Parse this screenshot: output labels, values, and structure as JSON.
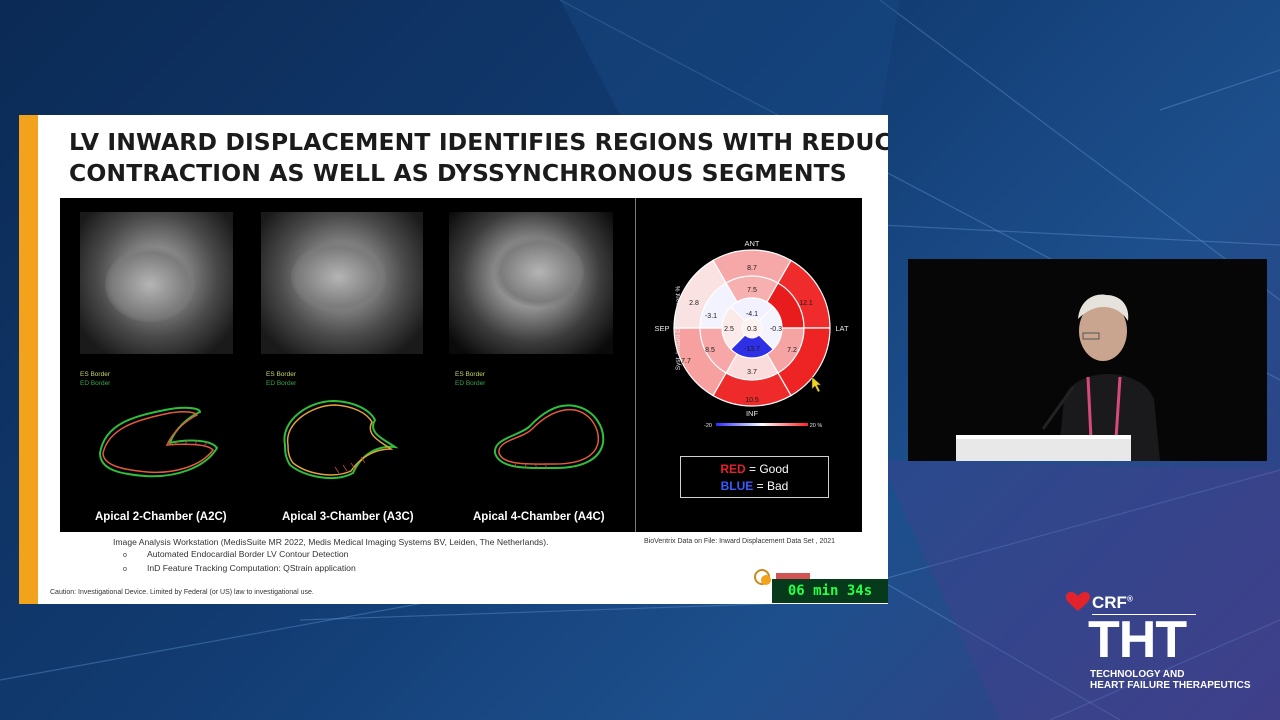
{
  "slide": {
    "title_line1": "LV INWARD DISPLACEMENT IDENTIFIES REGIONS WITH REDUCED",
    "title_line2": "CONTRACTION AS WELL AS DYSSYNCHRONOUS SEGMENTS",
    "views": [
      {
        "label": "Apical 2-Chamber (A2C)",
        "es": "ES Border",
        "ed": "ED Border"
      },
      {
        "label": "Apical 3-Chamber (A3C)",
        "es": "ES Border",
        "ed": "ED Border"
      },
      {
        "label": "Apical 4-Chamber (A4C)",
        "es": "ES Border",
        "ed": "ED Border"
      }
    ],
    "bullseye": {
      "ant": "ANT",
      "sep": "SEP",
      "lat": "LAT",
      "inf": "INF",
      "axis_label": "Syst. Inward Displacement %",
      "scale_min": "-20",
      "scale_max": "20 %",
      "values": {
        "outer_ant": "8.7",
        "outer_antlat": "12.1",
        "outer_antsep": "2.8",
        "outer_infsep": "7.7",
        "outer_inf": "10.5",
        "mid_ant": "7.5",
        "mid_antsep": "-3.1",
        "mid_infsep": "8.5",
        "mid_inf": "3.7",
        "mid_inflat": "7.2",
        "apical_ant": "-4.1",
        "apical_sep": "2.5",
        "apex": "0.3",
        "apical_lat": "-0.3",
        "apical_inf": "-13.7"
      }
    },
    "legend": {
      "red_word": "RED",
      "red_text": " = Good",
      "blue_word": "BLUE",
      "blue_text": " = Bad"
    },
    "footnote_main": "Image Analysis Workstation (MedisSuite MR 2022, Medis Medical Imaging Systems BV, Leiden, The Netherlands).",
    "footnote_sub1": "Automated Endocardial Border LV Contour Detection",
    "footnote_sub2": "InD Feature Tracking Computation: QStrain application",
    "bullet": "o",
    "footnote_right": "BioVentrix Data on File: Inward Displacement Data Set , 2021",
    "caution": "Caution: Investigational Device.  Limited by Federal (or US) law to investigational use."
  },
  "timer": "06 min 34s",
  "brand": {
    "crf": "CRF",
    "crf_reg": "®",
    "tht": "THT",
    "tag_line1": "TECHNOLOGY AND",
    "tag_line2": "HEART FAILURE THERAPEUTICS"
  },
  "colors": {
    "accent": "#f3a21b",
    "good_red": "#e3232b",
    "bad_blue": "#3a5cff",
    "timer_green": "#26ff48"
  }
}
